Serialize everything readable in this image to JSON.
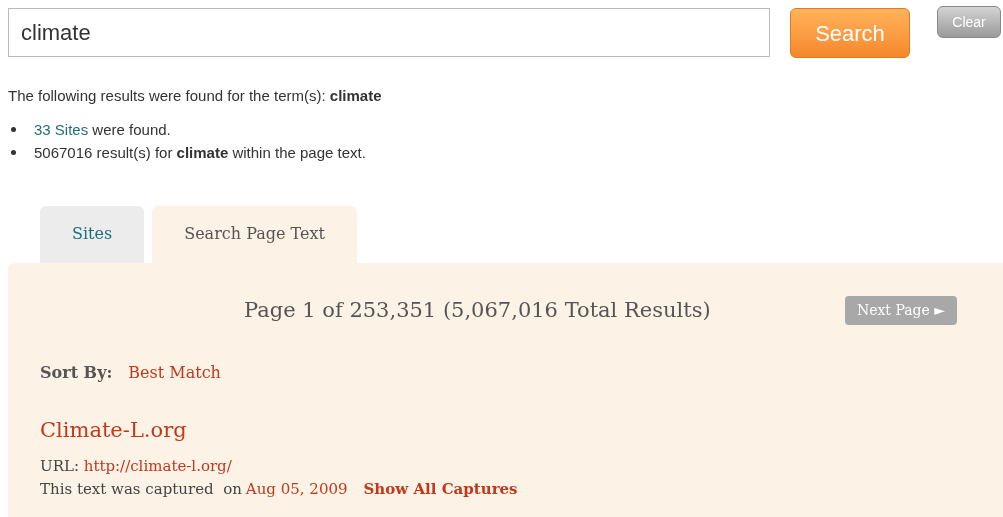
{
  "search": {
    "value": "climate",
    "button": "Search",
    "clear": "Clear"
  },
  "summary": "The following results were found for the term(s): **climate**",
  "bullets": [
    {
      "link": "33 Sites",
      "text": " were found."
    },
    {
      "text": "5067016 result(s) for **climate** within the page text."
    }
  ],
  "tabs": [
    {
      "label": "Sites",
      "selected": false
    },
    {
      "label": "Search Page Text",
      "selected": true
    }
  ],
  "pager": {
    "text": "Page 1 of 253,351 (5,067,016 Total Results)",
    "next": "Next Page ►"
  },
  "sort": {
    "label": "Sort By:",
    "value": "Best Match"
  },
  "results": [
    {
      "title": "Climate-L.org",
      "url_label": "URL:",
      "url": "http://climate-l.org/",
      "captured_prefix": "This text was captured  on",
      "date": "Aug 05, 2009",
      "captures": "Show All Captures"
    }
  ]
}
